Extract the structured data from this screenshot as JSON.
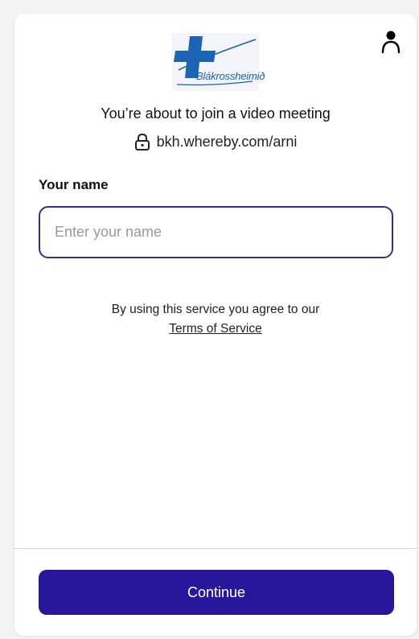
{
  "header": {
    "logo_text": "Blákrossheimið",
    "user_icon": "user-icon"
  },
  "meeting": {
    "heading": "You’re about to join a video meeting",
    "url": "bkh.whereby.com/arni",
    "lock_icon": "lock-icon"
  },
  "form": {
    "name_label": "Your name",
    "name_placeholder": "Enter your name",
    "name_value": ""
  },
  "terms": {
    "text": "By using this service you agree to our",
    "link_label": "Terms of Service"
  },
  "footer": {
    "continue_label": "Continue"
  },
  "colors": {
    "accent": "#28169b",
    "input_border": "#3d2a8f",
    "logo_blue": "#1a63b5"
  }
}
